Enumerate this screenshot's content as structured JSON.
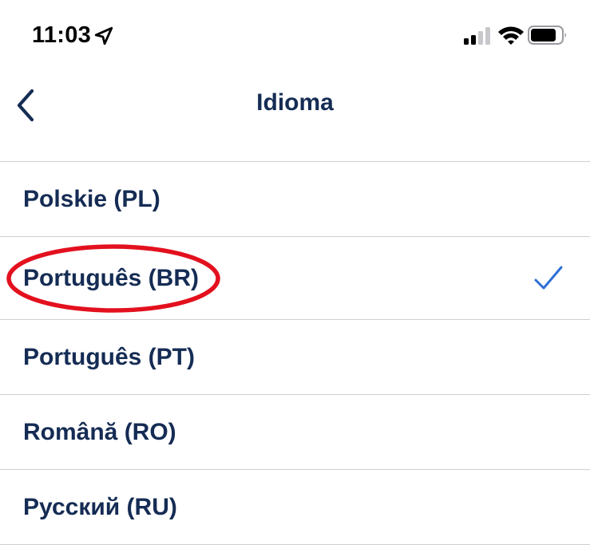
{
  "status_bar": {
    "time": "11:03",
    "icons": [
      "location-arrow-icon",
      "cellular-signal-icon",
      "wifi-icon",
      "battery-icon"
    ]
  },
  "nav": {
    "title": "Idioma",
    "back_icon": "chevron-left-icon"
  },
  "languages": [
    {
      "label": "Polskie (PL)",
      "selected": false
    },
    {
      "label": "Português (BR)",
      "selected": true
    },
    {
      "label": "Português (PT)",
      "selected": false
    },
    {
      "label": "Română (RO)",
      "selected": false
    },
    {
      "label": "Русский (RU)",
      "selected": false
    }
  ],
  "annotation": {
    "shape": "ellipse",
    "color": "#e3101e",
    "target": "Português (BR)"
  },
  "colors": {
    "text": "#152c54",
    "accent": "#2f6fd6",
    "divider": "#cfcfd4",
    "annotation": "#e3101e"
  }
}
